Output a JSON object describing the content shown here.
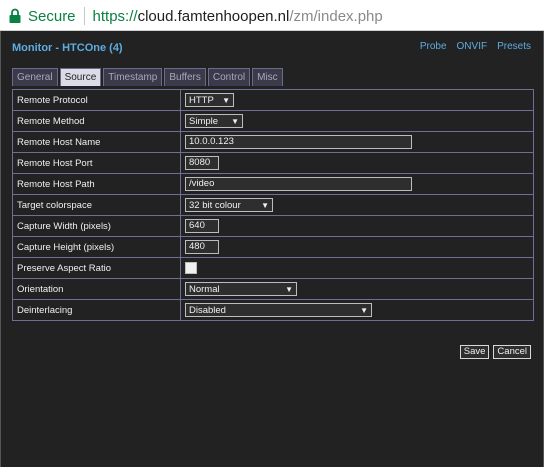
{
  "browser": {
    "secure_label": "Secure",
    "url_scheme": "https://",
    "url_host": "cloud.famtenhoopen.nl",
    "url_path": "/zm/index.php"
  },
  "page": {
    "title": "Monitor - HTCOne (4)",
    "links": [
      "Probe",
      "ONVIF",
      "Presets"
    ]
  },
  "tabs": [
    "General",
    "Source",
    "Timestamp",
    "Buffers",
    "Control",
    "Misc"
  ],
  "active_tab": "Source",
  "fields": {
    "remote_protocol": {
      "label": "Remote Protocol",
      "value": "HTTP"
    },
    "remote_method": {
      "label": "Remote Method",
      "value": "Simple"
    },
    "remote_host_name": {
      "label": "Remote Host Name",
      "value": "10.0.0.123"
    },
    "remote_host_port": {
      "label": "Remote Host Port",
      "value": "8080"
    },
    "remote_host_path": {
      "label": "Remote Host Path",
      "value": "/video"
    },
    "target_colorspace": {
      "label": "Target colorspace",
      "value": "32 bit colour"
    },
    "capture_width": {
      "label": "Capture Width (pixels)",
      "value": "640"
    },
    "capture_height": {
      "label": "Capture Height (pixels)",
      "value": "480"
    },
    "preserve_aspect": {
      "label": "Preserve Aspect Ratio",
      "checked": false
    },
    "orientation": {
      "label": "Orientation",
      "value": "Normal"
    },
    "deinterlacing": {
      "label": "Deinterlacing",
      "value": "Disabled"
    }
  },
  "buttons": {
    "save": "Save",
    "cancel": "Cancel"
  },
  "colors": {
    "link": "#5dade2",
    "secure": "#0b8043",
    "background": "#222222"
  }
}
